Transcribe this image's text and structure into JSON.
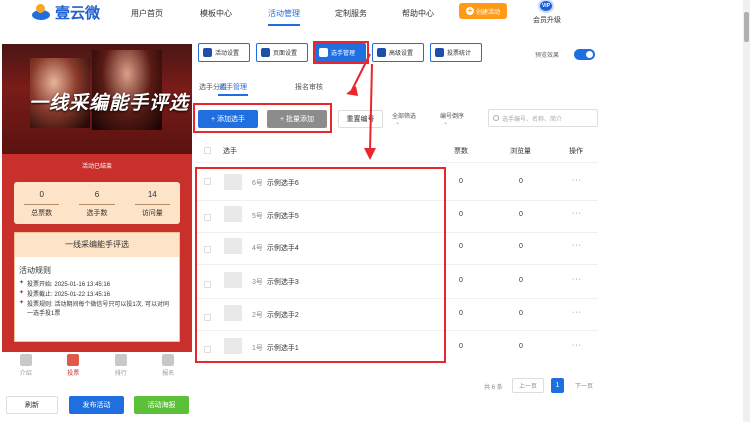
{
  "header": {
    "logo_text": "壹云微",
    "nav": [
      "用户首页",
      "模板中心",
      "活动管理",
      "定制服务",
      "帮助中心"
    ],
    "active_nav": "活动管理",
    "create_label": "创建活动",
    "vip_badge": "VIP",
    "vip_label": "会员升级"
  },
  "preview": {
    "banner_title": "一线采编能手评选",
    "status": "活动已结束",
    "stats": [
      {
        "value": "0",
        "label": "总票数"
      },
      {
        "value": "6",
        "label": "选手数"
      },
      {
        "value": "14",
        "label": "访问量"
      }
    ],
    "card_title": "一线采编能手评选",
    "rules_title": "活动规则",
    "rules": [
      {
        "mark": "✦",
        "text": "投票开始: 2025-01-16 13:45:16"
      },
      {
        "mark": "✦",
        "text": "投票截止: 2025-01-22 13:45:16"
      },
      {
        "mark": "✦",
        "text": "投票规则: 活动期间每个微信号只可以投1次, 可以对同一选手投1票"
      }
    ],
    "tabbar": [
      "介绍",
      "投票",
      "排行",
      "报名"
    ],
    "active_tab": "投票"
  },
  "bottom_buttons": {
    "refresh": "刷新",
    "publish": "发布活动",
    "poster": "活动海报"
  },
  "toolbar": [
    "活动设置",
    "页面设置",
    "选手管理",
    "高级设置",
    "投票统计"
  ],
  "active_toolbar": "选手管理",
  "preview_toggle": {
    "label": "预览效果",
    "on": true
  },
  "subtabs": [
    "选手分组",
    "选手管理",
    "报名审核"
  ],
  "active_subtab": "选手管理",
  "actions": {
    "add": "+ 添加选手",
    "bulk_add": "+ 批量添加",
    "reset_no": "重置编号"
  },
  "filters": {
    "all": "全部筛选",
    "sort": "编号倒序",
    "search_placeholder": "选手编号、名称、简介"
  },
  "table": {
    "headers": {
      "player": "选手",
      "votes": "票数",
      "views": "浏览量",
      "actions": "操作"
    },
    "rows": [
      {
        "no": "6号",
        "name": "示例选手6",
        "votes": "0",
        "views": "0",
        "more": "···"
      },
      {
        "no": "5号",
        "name": "示例选手5",
        "votes": "0",
        "views": "0",
        "more": "···"
      },
      {
        "no": "4号",
        "name": "示例选手4",
        "votes": "0",
        "views": "0",
        "more": "···"
      },
      {
        "no": "3号",
        "name": "示例选手3",
        "votes": "0",
        "views": "0",
        "more": "···"
      },
      {
        "no": "2号",
        "name": "示例选手2",
        "votes": "0",
        "views": "0",
        "more": "···"
      },
      {
        "no": "1号",
        "name": "示例选手1",
        "votes": "0",
        "views": "0",
        "more": "···"
      }
    ]
  },
  "pagination": {
    "total": "共 6 条",
    "prev": "上一页",
    "current": "1",
    "next": "下一页"
  },
  "colors": {
    "accent": "#1f6fe0",
    "brand_red": "#c92f2b",
    "highlight": "#e8262b",
    "orange": "#ff9a17",
    "green": "#5cc138"
  }
}
